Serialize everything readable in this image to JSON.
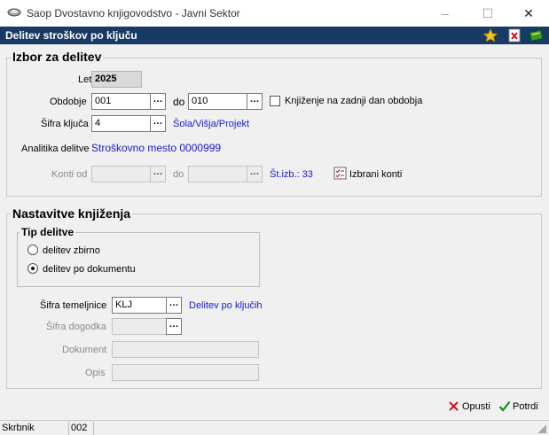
{
  "window": {
    "title": "Saop Dvostavno knjigovodstvo - Javni Sektor",
    "minimize": "–",
    "maximize": "☐",
    "close": "✕"
  },
  "header": {
    "title": "Delitev stroškov po ključu"
  },
  "izbor": {
    "legend": "Izbor za delitev",
    "leto_label": "Leto",
    "leto_value": "2025",
    "obdobje_label": "Obdobje",
    "obdobje_from": "001",
    "do_label": "do",
    "obdobje_to": "010",
    "knjizenje_label": "Knjiženje na zadnji dan obdobja",
    "sifra_kljuca_label": "Šifra ključa",
    "sifra_kljuca_value": "4",
    "sifra_kljuca_desc": "Šola/Višja/Projekt",
    "analitika_label": "Analitika delitve",
    "analitika_value": "Stroškovno mesto 0000999",
    "konti_od_label": "Konti od",
    "konti_do_label": "do",
    "st_izb": "Št.izb.: 33",
    "izbrani_konti": "Izbrani konti"
  },
  "nastavitve": {
    "legend": "Nastavitve knjiženja",
    "tip_legend": "Tip delitve",
    "radio_zbirno": "delitev zbirno",
    "radio_dokument": "delitev po dokumentu",
    "sifra_temeljnice_label": "Šifra temeljnice",
    "sifra_temeljnice_value": "KLJ",
    "sifra_temeljnice_desc": "Delitev po ključih",
    "sifra_dogodka_label": "Šifra dogodka",
    "dokument_label": "Dokument",
    "opis_label": "Opis"
  },
  "actions": {
    "cancel": "Opusti",
    "confirm": "Potrdi"
  },
  "status": {
    "user": "Skrbnik",
    "code": "002"
  },
  "colors": {
    "header_bg": "#183a66",
    "link": "#1a1acf",
    "accent_green": "#1c8a1c",
    "cancel_red": "#cc1111"
  }
}
